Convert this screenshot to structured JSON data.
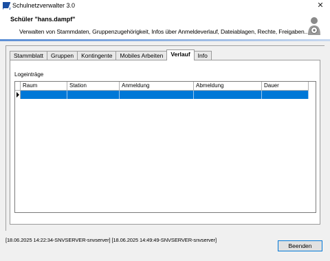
{
  "window": {
    "title": "Schulnetzverwalter 3.0",
    "close_glyph": "✕"
  },
  "header": {
    "title": "Schüler \"hans.dampf\"",
    "description": "Verwalten von Stammdaten, Gruppenzugehörigkeit, Infos über Anmeldeverlauf, Dateiablagen, Rechte, Freigaben..."
  },
  "tabs": [
    {
      "label": "Stammblatt"
    },
    {
      "label": "Gruppen"
    },
    {
      "label": "Kontingente"
    },
    {
      "label": "Mobiles Arbeiten"
    },
    {
      "label": "Verlauf"
    },
    {
      "label": "Info"
    }
  ],
  "log": {
    "label": "Logeinträge",
    "columns": [
      "Raum",
      "Station",
      "Anmeldung",
      "Abmeldung",
      "Dauer"
    ]
  },
  "status": {
    "text": "[18.06.2025 14:22:34-SNVSERVER-snvserver] [18.06.2025 14:49:49-SNVSERVER-snvserver]"
  },
  "buttons": {
    "close_label": "Beenden"
  },
  "colors": {
    "selection": "#0078d7",
    "accent_line": "#5c8fd6"
  }
}
